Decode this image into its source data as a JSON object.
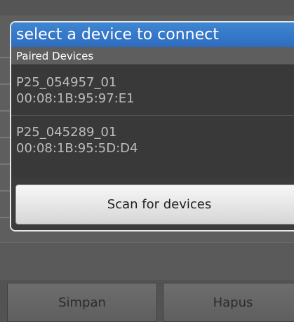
{
  "dialog": {
    "title": "select a device to connect",
    "section_header": "Paired Devices",
    "devices": [
      {
        "name": "P25_054957_01",
        "address": "00:08:1B:95:97:E1"
      },
      {
        "name": "P25_045289_01",
        "address": "00:08:1B:95:5D:D4"
      }
    ],
    "scan_label": "Scan for devices"
  },
  "bottom_bar": {
    "simpan_label": "Simpan",
    "hapus_label": "Hapus"
  },
  "colors": {
    "title_bar": "#3a7fcf",
    "dialog_bg": "#393939",
    "section_header_bg": "#5e5e5e"
  }
}
